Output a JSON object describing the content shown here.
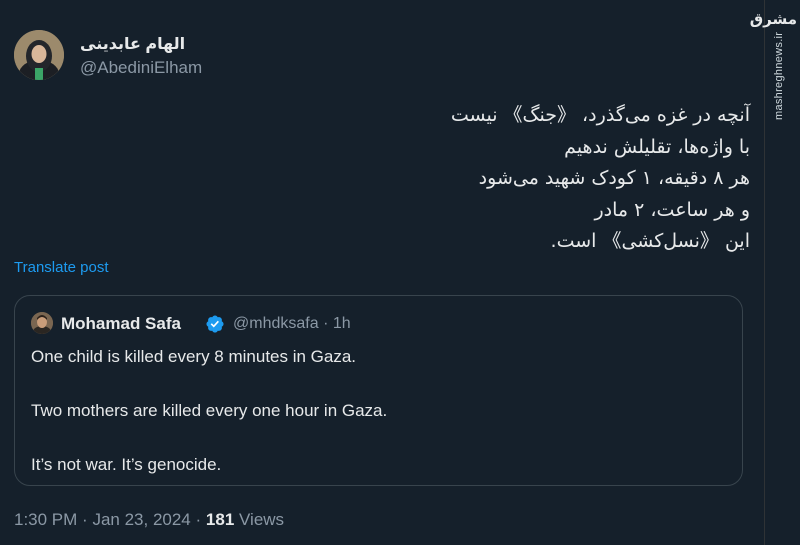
{
  "author": {
    "display_name": "الهام عابدینی",
    "handle": "@AbediniElham"
  },
  "tweet": {
    "lines": [
      "آنچه در غزه می‌گذرد، 《جنگ》 نیست",
      "با واژه‌ها، تقلیلش ندهیم",
      "هر ۸ دقیقه، ۱ کودک شهید می‌شود",
      "و هر ساعت، ۲ مادر",
      "این 《نسل‌کشی》 است."
    ],
    "translate_label": "Translate post"
  },
  "quoted": {
    "name": "Mohamad Safa",
    "handle": "@mhdksafa",
    "separator": "·",
    "time": "1h",
    "lines": [
      "One child is killed every 8 minutes in Gaza.",
      "Two mothers are killed every one hour in Gaza.",
      "It’s not war. It’s genocide."
    ]
  },
  "footer": {
    "time": "1:30 PM",
    "separator": "·",
    "date": "Jan 23, 2024",
    "separator2": "·",
    "views_count": "181",
    "views_label": "Views"
  },
  "watermark": {
    "logo": "مشرق",
    "site": "mashreghnews.ir"
  },
  "colors": {
    "background": "#15202b",
    "text": "#e7e9ea",
    "secondary": "#8b98a5",
    "link": "#1d9bf0",
    "border": "#38444d"
  },
  "icons": {
    "verified": "verified-badge-icon"
  }
}
